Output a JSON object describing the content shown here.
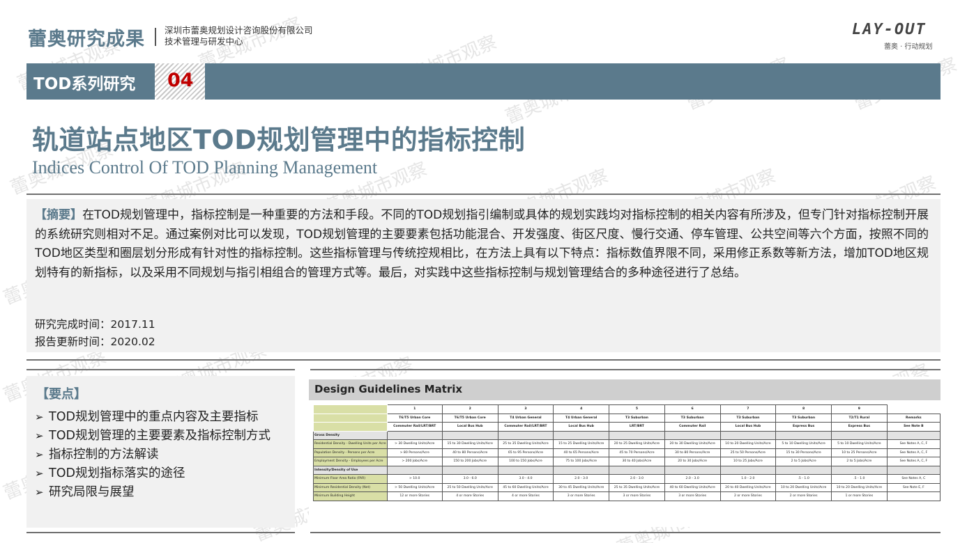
{
  "header": {
    "brand": "蕾奥研究成果",
    "company_line1": "深圳市蕾奥规划设计咨询股份有限公司",
    "company_line2": "技术管理与研发中心",
    "logo_text": "LAY-OUT",
    "logo_sub": "蕾奥 · 行动规划"
  },
  "banner": {
    "label": "TOD系列研究",
    "number": "04",
    "color": "#5b7a8c"
  },
  "title": {
    "cn": "轨道站点地区TOD规划管理中的指标控制",
    "en": "Indices Control Of TOD Planning Management"
  },
  "abstract": {
    "tag": "【摘要】",
    "text": "在TOD规划管理中，指标控制是一种重要的方法和手段。不同的TOD规划指引编制或具体的规划实践均对指标控制的相关内容有所涉及，但专门针对指标控制开展的系统研究则相对不足。通过案例对比可以发现，TOD规划管理的主要要素包括功能混合、开发强度、街区尺度、慢行交通、停车管理、公共空间等六个方面，按照不同的TOD地区类型和圈层划分形成有针对性的指标控制。这些指标管理与传统控规相比，在方法上具有以下特点：指标数值界限不同，采用修正系数等新方法，增加TOD地区规划特有的新指标，以及采用不同规划与指引相组合的管理方式等。最后，对实践中这些指标控制与规划管理结合的多种途径进行了总结。",
    "completed": "研究完成时间：2017.11",
    "updated": "报告更新时间：2020.02"
  },
  "key_points": {
    "title": "【要点】",
    "items": [
      "TOD规划管理中的重点内容及主要指标",
      "TOD规划管理的主要要素及指标控制方式",
      "指标控制的方法解读",
      "TOD规划指标落实的途径",
      "研究局限与展望"
    ]
  },
  "matrix": {
    "title": "Design Guidelines Matrix",
    "columns": [
      "1",
      "2",
      "3",
      "4",
      "5",
      "6",
      "7",
      "8",
      "9"
    ],
    "types": [
      "T6/T5 Urban Core",
      "T6/T5 Urban Core",
      "T4 Urban General",
      "T4 Urban General",
      "T3 Suburban",
      "T3 Suburban",
      "T3 Suburban",
      "T3 Suburban",
      "T2/T1 Rural",
      "Remarks"
    ],
    "modes": [
      "Commuter Rail/LRT/BRT",
      "Local Bus Hub",
      "Commuter Rail/LRT/BRT",
      "Local Bus Hub",
      "LRT/BRT",
      "Commuter Rail",
      "Local Bus Hub",
      "Express Bus",
      "Express Bus",
      "See Note B"
    ],
    "sections": [
      {
        "name": "Gross Density",
        "rows": [
          {
            "label": "Residential Density - Dwelling Units per Acre",
            "cells": [
              "> 30 Dwelling Units/Acre",
              "15 to 30 Dwelling Units/Acre",
              "25 to 35 Dwelling Units/Acre",
              "15 to 25 Dwelling Units/Acre",
              "20 to 25 Dwelling Units/Acre",
              "20 to 30 Dwelling Units/Acre",
              "10 to 20 Dwelling Units/Acre",
              "5 to 10 Dwelling Units/Acre",
              "5 to 10 Dwelling Units/Acre",
              "See Notes A, C, F"
            ]
          },
          {
            "label": "Population Density - Persons per Acre",
            "cells": [
              "> 80 Persons/Acre",
              "40 to 80 Persons/Acre",
              "65 to 95 Persons/Acre",
              "40 to 65 Persons/Acre",
              "45 to 70 Persons/Acre",
              "30 to 80 Persons/Acre",
              "25 to 50 Persons/Acre",
              "15 to 30 Persons/Acre",
              "10 to 25 Persons/Acre",
              "See Notes A, C, F"
            ]
          },
          {
            "label": "Employment Density - Employees per Acre",
            "cells": [
              "> 200 Jobs/Acre",
              "150 to 200 Jobs/Acre",
              "100 to 150 Jobs/Acre",
              "75 to 100 Jobs/Acre",
              "30 to 40 Jobs/Acre",
              "20 to 30 Jobs/Acre",
              "10 to 25 Jobs/Acre",
              "2 to 5 Jobs/Acre",
              "2 to 5 Jobs/Acre",
              "See Notes A, C, F"
            ]
          }
        ]
      },
      {
        "name": "Intensity/Density of Use",
        "rows": [
          {
            "label": "Minimum Floor Area Ratio (FAR)",
            "cells": [
              "> 10.0",
              "3.0 - 6.0",
              "3.0 - 4.0",
              "2.0 - 3.0",
              "2.0 - 3.0",
              "2.0 - 3.0",
              "1.0 - 2.0",
              ".5 - 1.0",
              ".5 - 1.0",
              "See Notes A, C"
            ]
          },
          {
            "label": "Minimum Residential Density (Net)",
            "cells": [
              "> 50 Dwelling Units/Acre",
              "25 to 50 Dwelling Units/Acre",
              "45 to 60 Dwelling Units/Acre",
              "30 to 45 Dwelling Units/Acre",
              "25 to 35 Dwelling Units/Acre",
              "40 to 60 Dwelling Units/Acre",
              "20 to 40 Dwelling Units/Acre",
              "10 to 20 Dwelling Units/Acre",
              "10 to 20 Dwelling Units/Acre",
              "See Note E, F"
            ]
          },
          {
            "label": "Minimum Building Height",
            "cells": [
              "12 or more Stories",
              "4 or more Stories",
              "4 or more Stories",
              "3 or more Stories",
              "3 or more Stories",
              "3 or more Stories",
              "2 or more Stories",
              "2 or more Stories",
              "1 or more Stories",
              ""
            ]
          }
        ]
      }
    ]
  },
  "watermark": "蕾奥城市观察"
}
